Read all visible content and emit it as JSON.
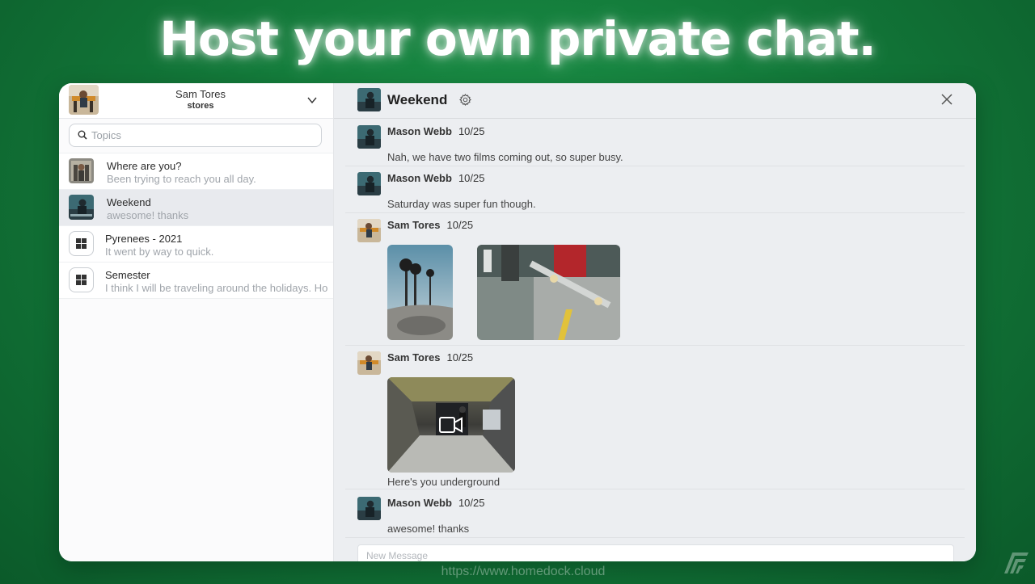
{
  "headline": "Host your own private chat.",
  "account": {
    "name": "Sam Tores",
    "handle": "stores"
  },
  "search": {
    "placeholder": "Topics"
  },
  "topics": [
    {
      "title": "Where are you?",
      "preview": "Been trying to reach you all day.",
      "selected": false,
      "avatar": "photo"
    },
    {
      "title": "Weekend",
      "preview": "awesome! thanks",
      "selected": true,
      "avatar": "photo"
    },
    {
      "title": "Pyrenees - 2021",
      "preview": "It went by way to quick.",
      "selected": false,
      "avatar": "grid-icon"
    },
    {
      "title": "Semester",
      "preview": "I think I will be traveling around the holidays. Ho",
      "selected": false,
      "avatar": "grid-icon"
    }
  ],
  "conversation": {
    "title": "Weekend",
    "messages": [
      {
        "author": "Mason Webb",
        "date": "10/25",
        "text": "Nah, we have two films coming out, so super busy."
      },
      {
        "author": "Mason Webb",
        "date": "10/25",
        "text": "Saturday was super fun though."
      },
      {
        "author": "Sam Tores",
        "date": "10/25",
        "attachments": [
          "photo-palm-trees-skatepark",
          "photo-skateboard-trick"
        ]
      },
      {
        "author": "Sam Tores",
        "date": "10/25",
        "attachments": [
          "video-underground-tunnel"
        ],
        "text": "Here's you underground"
      },
      {
        "author": "Mason Webb",
        "date": "10/25",
        "text": "awesome! thanks"
      }
    ]
  },
  "composer": {
    "placeholder": "New Message"
  },
  "footer_url": "https://www.homedock.cloud",
  "colors": {
    "background": "#137a3a",
    "panel": "#ffffff",
    "selected_row": "#e8eaee"
  }
}
